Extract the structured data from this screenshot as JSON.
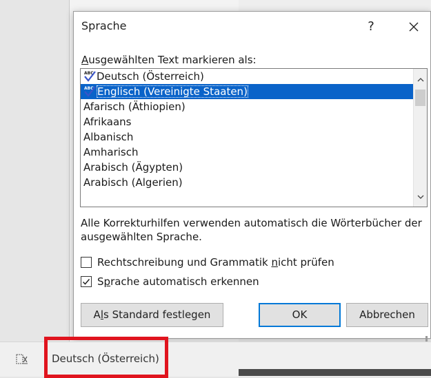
{
  "dialog": {
    "title": "Sprache",
    "help": "?",
    "close": "✕",
    "list_label_ul": "A",
    "list_label_rest": "usgewählten Text markieren als:",
    "languages": [
      {
        "label": "Deutsch (Österreich)",
        "spellcheck": true,
        "selected": false
      },
      {
        "label": "Englisch (Vereinigte Staaten)",
        "spellcheck": true,
        "selected": true
      },
      {
        "label": "Afarisch (Äthiopien)",
        "spellcheck": false,
        "selected": false
      },
      {
        "label": "Afrikaans",
        "spellcheck": false,
        "selected": false
      },
      {
        "label": "Albanisch",
        "spellcheck": false,
        "selected": false
      },
      {
        "label": "Amharisch",
        "spellcheck": false,
        "selected": false
      },
      {
        "label": "Arabisch (Ägypten)",
        "spellcheck": false,
        "selected": false
      },
      {
        "label": "Arabisch (Algerien)",
        "spellcheck": false,
        "selected": false
      }
    ],
    "info_text": "Alle Korrekturhilfen verwenden automatisch die Wörterbücher der ausgewählten Sprache.",
    "check_no_proofing": {
      "pre": "Rechtschreibung und Grammatik ",
      "ul": "n",
      "post": "icht prüfen",
      "checked": false
    },
    "check_auto_detect": {
      "pre": "S",
      "ul": "p",
      "post": "rache automatisch erkennen",
      "checked": true
    },
    "buttons": {
      "set_default": {
        "pre": "A",
        "ul": "l",
        "post": "s Standard festlegen"
      },
      "ok": "OK",
      "cancel": "Abbrechen"
    }
  },
  "statusbar": {
    "language": "Deutsch (Österreich)",
    "language_icon": "spellcheck-language-icon"
  },
  "colors": {
    "selection": "#0a63c9",
    "highlight_box": "#e0141e",
    "default_button_border": "#0078d7"
  }
}
